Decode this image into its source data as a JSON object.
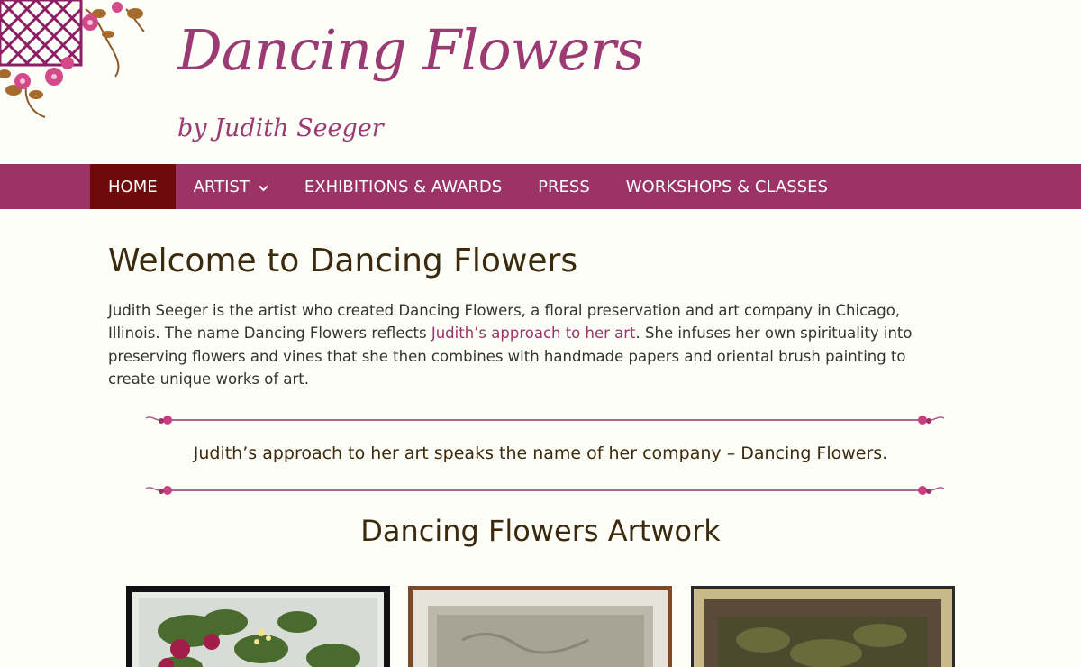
{
  "header": {
    "title": "Dancing Flowers",
    "tagline": "by Judith Seeger"
  },
  "nav": {
    "items": [
      {
        "label": "HOME",
        "active": true
      },
      {
        "label": "ARTIST",
        "has_dropdown": true
      },
      {
        "label": "EXHIBITIONS & AWARDS"
      },
      {
        "label": "PRESS"
      },
      {
        "label": "WORKSHOPS & CLASSES"
      }
    ]
  },
  "main": {
    "heading": "Welcome to Dancing Flowers",
    "intro_before_link": "Judith Seeger is the artist who created Dancing Flowers, a floral preservation and art company in Chicago, Illinois. The name Dancing Flowers reflects ",
    "intro_link": "Judith’s approach to her art",
    "intro_after_link": ". She infuses her own spirituality into preserving flowers and vines that she then combines with handmade papers and oriental brush painting to create unique works of art.",
    "quote": "Judith’s approach to her art speaks the name of her company – Dancing Flowers.",
    "artwork_heading": "Dancing Flowers Artwork"
  },
  "colors": {
    "brand": "#9b3366",
    "nav_active": "#6e0a0a",
    "background": "#fefef8",
    "text": "#3b2a0e"
  }
}
